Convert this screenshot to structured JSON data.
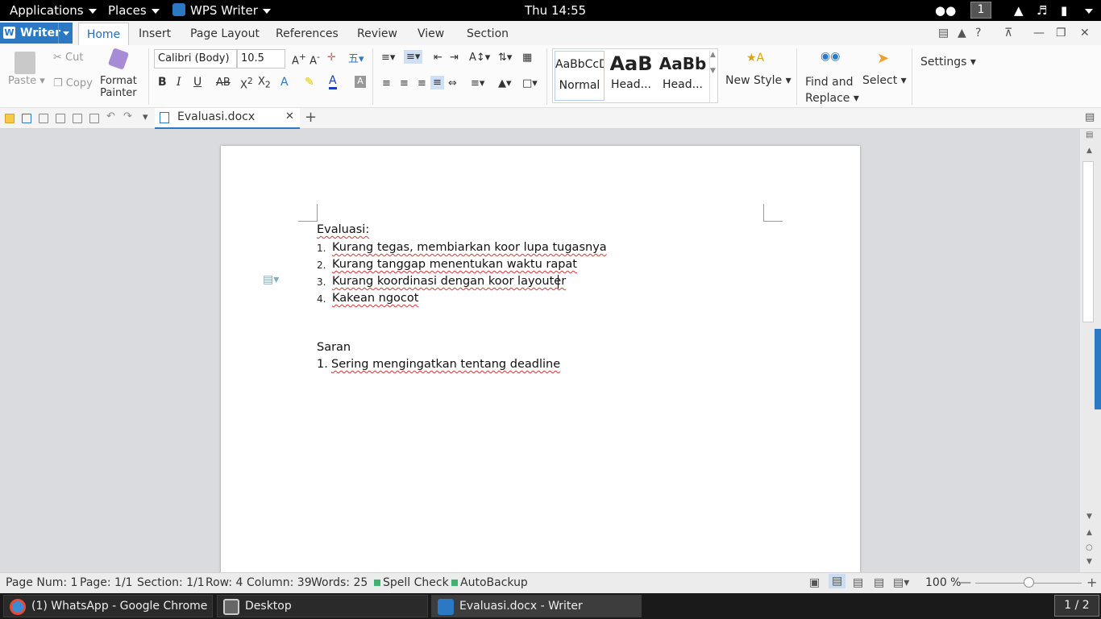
{
  "topbar": {
    "applications": "Applications",
    "places": "Places",
    "app": "WPS Writer",
    "clock": "Thu 14:55",
    "workspace": "1"
  },
  "titlebar": {
    "app_button": "Writer",
    "tabs": [
      "Home",
      "Insert",
      "Page Layout",
      "References",
      "Review",
      "View",
      "Section"
    ]
  },
  "ribbon": {
    "paste": "Paste",
    "cut": "Cut",
    "copy": "Copy",
    "format_painter_1": "Format",
    "format_painter_2": "Painter",
    "font_name": "Calibri (Body)",
    "font_size": "10.5",
    "styles": [
      {
        "preview": "AaBbCcD",
        "label": "Normal"
      },
      {
        "preview": "AaB",
        "label": "Head..."
      },
      {
        "preview": "AaBb",
        "label": "Head..."
      }
    ],
    "new_style": "New Style",
    "find_1": "Find and",
    "find_2": "Replace",
    "select": "Select",
    "settings": "Settings"
  },
  "doc_tab": {
    "name": "Evaluasi.docx"
  },
  "document": {
    "heading1": "Evaluasi:",
    "list1": [
      {
        "n": "1.",
        "text": "Kurang tegas, membiarkan koor lupa tugasnya"
      },
      {
        "n": "2.",
        "text": "Kurang tanggap menentukan waktu rapat"
      },
      {
        "n": "3.",
        "text": "Kurang koordinasi dengan koor layouter"
      },
      {
        "n": "4.",
        "text": "Kakean ngocot"
      }
    ],
    "heading2": "Saran",
    "list2": [
      {
        "n": "1.",
        "text": "Sering mengingatkan tentang deadline"
      }
    ]
  },
  "status": {
    "page_num": "Page Num: 1",
    "page": "Page: 1/1",
    "section": "Section: 1/1",
    "row": "Row: 4",
    "column": "Column: 39",
    "words": "Words: 25",
    "spell": "Spell Check",
    "autobackup": "AutoBackup",
    "zoom": "100 %"
  },
  "taskbar": {
    "items": [
      "(1) WhatsApp - Google Chrome",
      "Desktop",
      "Evaluasi.docx - Writer"
    ],
    "pager": "1 / 2"
  },
  "colors": {
    "accent": "#2b78c5",
    "squiggle": "#d33"
  }
}
